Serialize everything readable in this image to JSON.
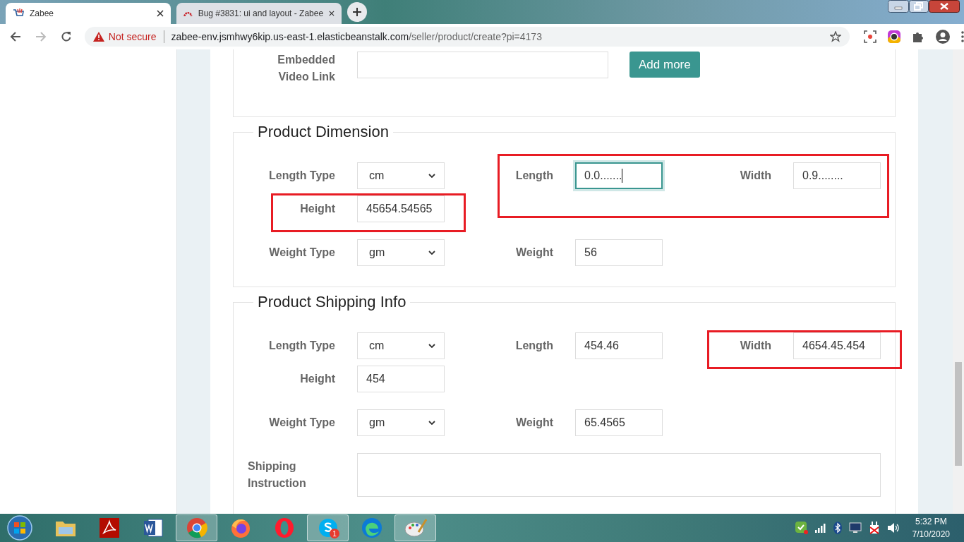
{
  "browser": {
    "tabs": [
      {
        "title": "Zabee",
        "selected": true
      },
      {
        "title": "Bug #3831: ui and layout - Zabee",
        "selected": false
      }
    ],
    "security": "Not secure",
    "url_host": "zabee-env.jsmhwy6kip.us-east-1.elasticbeanstalk.com",
    "url_path": "/seller/product/create?pi=4173"
  },
  "video": {
    "label": "Embedded Video Link",
    "button": "Add more"
  },
  "sections": [
    {
      "title": "Product Dimension",
      "rows": [
        {
          "items": [
            {
              "kind": "select",
              "label": "Length Type",
              "value": "cm",
              "highlighted": false
            },
            {
              "kind": "group",
              "highlighted": true,
              "fields": [
                {
                  "kind": "input",
                  "label": "Length",
                  "value": "0.0.......",
                  "focused": true
                },
                {
                  "kind": "input",
                  "label": "Width",
                  "value": "0.9........",
                  "focused": false
                }
              ]
            },
            {
              "kind": "input",
              "label": "Height",
              "value": "45654.54565",
              "focused": false,
              "highlighted": true
            }
          ]
        },
        {
          "items": [
            {
              "kind": "select",
              "label": "Weight Type",
              "value": "gm",
              "highlighted": false
            },
            {
              "kind": "input",
              "label": "Weight",
              "value": "56",
              "focused": false,
              "highlighted": false
            }
          ]
        }
      ]
    },
    {
      "title": "Product Shipping Info",
      "rows": [
        {
          "items": [
            {
              "kind": "select",
              "label": "Length Type",
              "value": "cm",
              "highlighted": false
            },
            {
              "kind": "input",
              "label": "Length",
              "value": "454.46",
              "focused": false,
              "highlighted": false
            },
            {
              "kind": "input",
              "label": "Width",
              "value": "4654.45.454",
              "focused": false,
              "highlighted": true
            },
            {
              "kind": "input",
              "label": "Height",
              "value": "454",
              "focused": false,
              "highlighted": false
            }
          ]
        },
        {
          "items": [
            {
              "kind": "select",
              "label": "Weight Type",
              "value": "gm",
              "highlighted": false
            },
            {
              "kind": "input",
              "label": "Weight",
              "value": "65.4565",
              "focused": false,
              "highlighted": false
            }
          ]
        },
        {
          "items": [
            {
              "kind": "textarea",
              "label": "Shipping Instruction",
              "highlighted": false
            }
          ]
        }
      ]
    }
  ],
  "taskbar": {
    "items": [
      {
        "kind": "folder",
        "active": false
      },
      {
        "kind": "pdf",
        "active": false
      },
      {
        "kind": "word",
        "active": false
      },
      {
        "kind": "chrome",
        "active": true
      },
      {
        "kind": "firefox",
        "active": false
      },
      {
        "kind": "opera",
        "active": false
      },
      {
        "kind": "skype",
        "active": true,
        "badge": "1"
      },
      {
        "kind": "edge",
        "active": false
      },
      {
        "kind": "paint",
        "active": true
      }
    ],
    "time": "5:32 PM",
    "date": "7/10/2020"
  }
}
